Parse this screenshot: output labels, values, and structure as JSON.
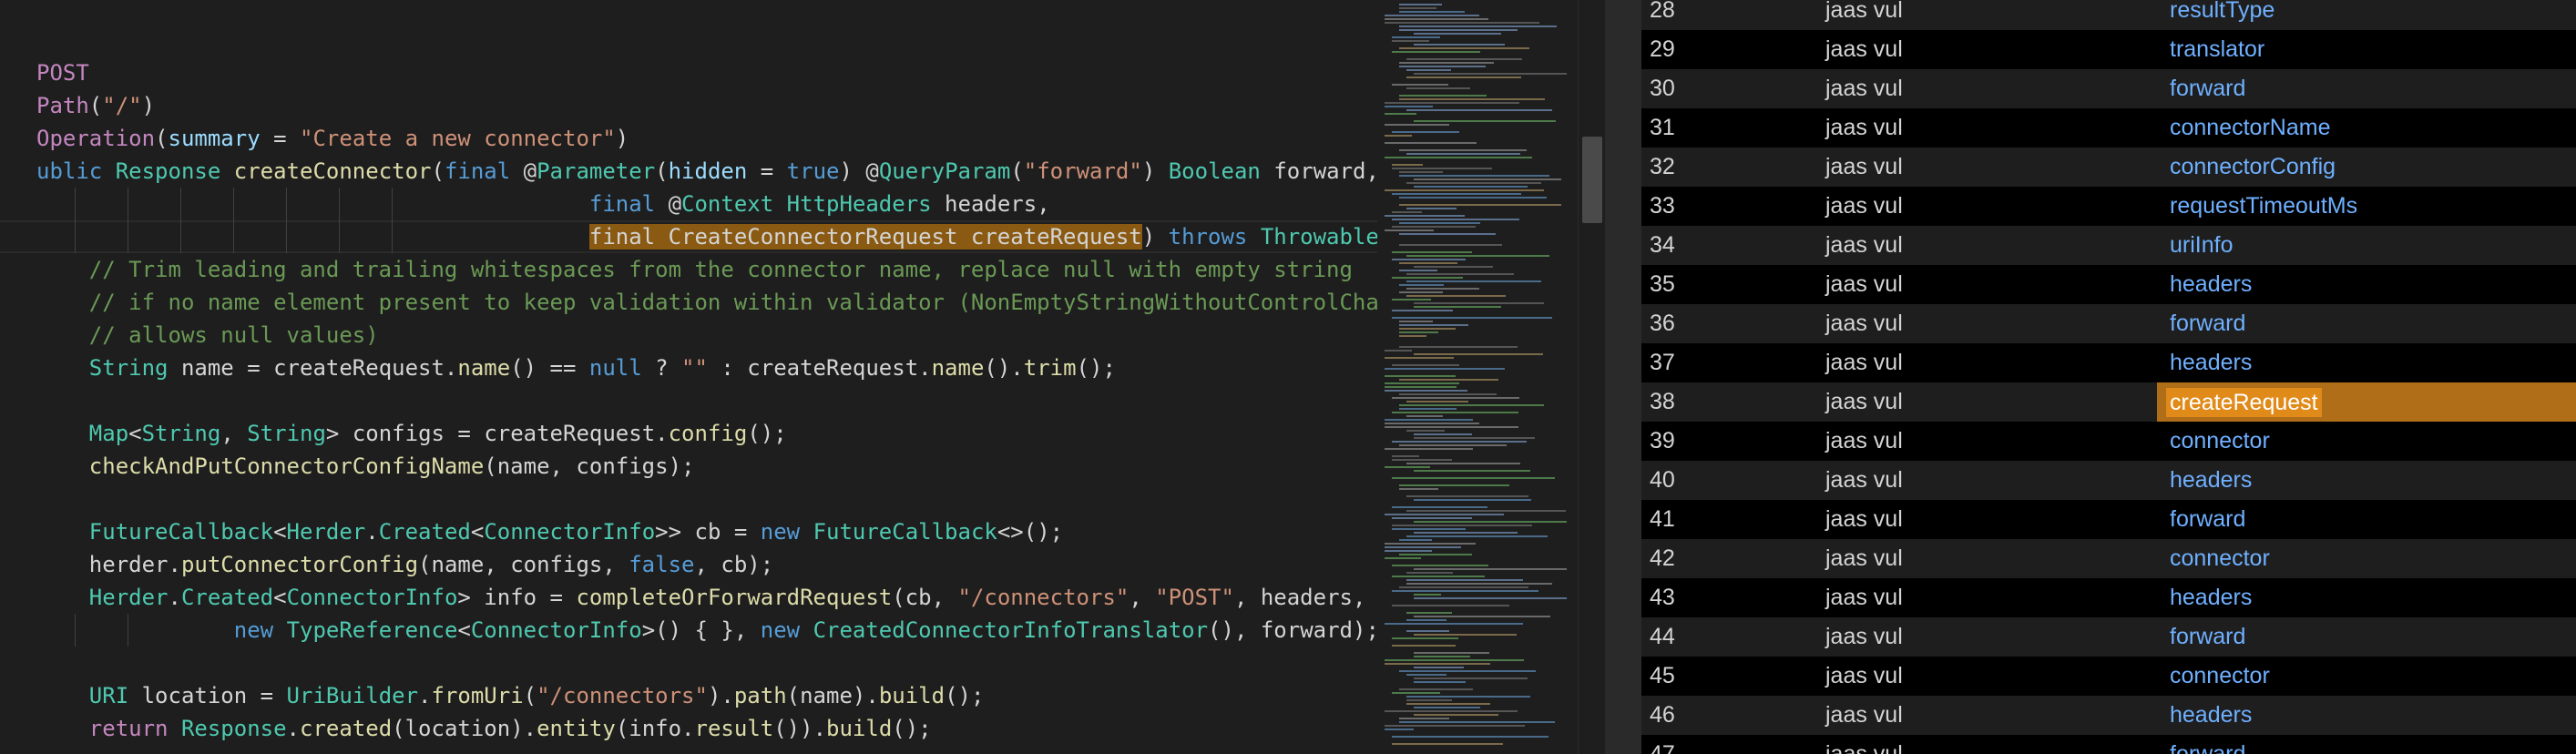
{
  "editor": {
    "lines": [
      [
        {
          "t": "POST",
          "c": "kc"
        }
      ],
      [
        {
          "t": "Path",
          "c": "kc"
        },
        {
          "t": "(",
          "c": "wh"
        },
        {
          "t": "\"/\"",
          "c": "s"
        },
        {
          "t": ")",
          "c": "wh"
        }
      ],
      [
        {
          "t": "Operation",
          "c": "kc"
        },
        {
          "t": "(",
          "c": "wh"
        },
        {
          "t": "summary",
          "c": "p"
        },
        {
          "t": " = ",
          "c": "wh"
        },
        {
          "t": "\"Create a new connector\"",
          "c": "s"
        },
        {
          "t": ")",
          "c": "wh"
        }
      ],
      [
        {
          "t": "ublic",
          "c": "k"
        },
        {
          "t": " ",
          "c": "wh"
        },
        {
          "t": "Response",
          "c": "t"
        },
        {
          "t": " ",
          "c": "wh"
        },
        {
          "t": "createConnector",
          "c": "f"
        },
        {
          "t": "(",
          "c": "wh"
        },
        {
          "t": "final",
          "c": "k"
        },
        {
          "t": " @",
          "c": "wh"
        },
        {
          "t": "Parameter",
          "c": "t"
        },
        {
          "t": "(",
          "c": "wh"
        },
        {
          "t": "hidden",
          "c": "p"
        },
        {
          "t": " = ",
          "c": "wh"
        },
        {
          "t": "true",
          "c": "k"
        },
        {
          "t": ") @",
          "c": "wh"
        },
        {
          "t": "QueryParam",
          "c": "t"
        },
        {
          "t": "(",
          "c": "wh"
        },
        {
          "t": "\"forward\"",
          "c": "s"
        },
        {
          "t": ") ",
          "c": "wh"
        },
        {
          "t": "Boolean",
          "c": "t"
        },
        {
          "t": " forward,",
          "c": "wh"
        }
      ],
      [
        {
          "t": "                                          ",
          "c": "wh"
        },
        {
          "t": "final",
          "c": "k"
        },
        {
          "t": " @",
          "c": "wh"
        },
        {
          "t": "Context",
          "c": "t"
        },
        {
          "t": " ",
          "c": "wh"
        },
        {
          "t": "HttpHeaders",
          "c": "t"
        },
        {
          "t": " headers,",
          "c": "wh"
        }
      ],
      [
        {
          "t": "                                          ",
          "c": "wh"
        },
        {
          "t": "final CreateConnectorRequest createRequest",
          "c": "sel"
        },
        {
          "t": ") ",
          "c": "wh"
        },
        {
          "t": "throws",
          "c": "k"
        },
        {
          "t": " ",
          "c": "wh"
        },
        {
          "t": "Throwable",
          "c": "t"
        },
        {
          "t": " {",
          "c": "f"
        }
      ],
      [
        {
          "t": "    // Trim leading and trailing whitespaces from the connector name, replace null with empty string",
          "c": "c"
        }
      ],
      [
        {
          "t": "    // if no name element present to keep validation within validator (NonEmptyStringWithoutControlChar",
          "c": "c"
        }
      ],
      [
        {
          "t": "    // allows null values)",
          "c": "c"
        }
      ],
      [
        {
          "t": "    ",
          "c": "wh"
        },
        {
          "t": "String",
          "c": "t"
        },
        {
          "t": " name = createRequest.",
          "c": "wh"
        },
        {
          "t": "name",
          "c": "f"
        },
        {
          "t": "() == ",
          "c": "wh"
        },
        {
          "t": "null",
          "c": "k"
        },
        {
          "t": " ? ",
          "c": "wh"
        },
        {
          "t": "\"\"",
          "c": "s"
        },
        {
          "t": " : createRequest.",
          "c": "wh"
        },
        {
          "t": "name",
          "c": "f"
        },
        {
          "t": "().",
          "c": "wh"
        },
        {
          "t": "trim",
          "c": "f"
        },
        {
          "t": "();",
          "c": "wh"
        }
      ],
      [],
      [
        {
          "t": "    ",
          "c": "wh"
        },
        {
          "t": "Map",
          "c": "t"
        },
        {
          "t": "<",
          "c": "wh"
        },
        {
          "t": "String",
          "c": "t"
        },
        {
          "t": ", ",
          "c": "wh"
        },
        {
          "t": "String",
          "c": "t"
        },
        {
          "t": "> configs = createRequest.",
          "c": "wh"
        },
        {
          "t": "config",
          "c": "f"
        },
        {
          "t": "();",
          "c": "wh"
        }
      ],
      [
        {
          "t": "    ",
          "c": "wh"
        },
        {
          "t": "checkAndPutConnectorConfigName",
          "c": "f"
        },
        {
          "t": "(name, configs);",
          "c": "wh"
        }
      ],
      [],
      [
        {
          "t": "    ",
          "c": "wh"
        },
        {
          "t": "FutureCallback",
          "c": "t"
        },
        {
          "t": "<",
          "c": "wh"
        },
        {
          "t": "Herder",
          "c": "t"
        },
        {
          "t": ".",
          "c": "wh"
        },
        {
          "t": "Created",
          "c": "t"
        },
        {
          "t": "<",
          "c": "wh"
        },
        {
          "t": "ConnectorInfo",
          "c": "t"
        },
        {
          "t": ">> cb = ",
          "c": "wh"
        },
        {
          "t": "new",
          "c": "k"
        },
        {
          "t": " ",
          "c": "wh"
        },
        {
          "t": "FutureCallback",
          "c": "t"
        },
        {
          "t": "<>();",
          "c": "wh"
        }
      ],
      [
        {
          "t": "    herder.",
          "c": "wh"
        },
        {
          "t": "putConnectorConfig",
          "c": "f"
        },
        {
          "t": "(name, configs, ",
          "c": "wh"
        },
        {
          "t": "false",
          "c": "k"
        },
        {
          "t": ", cb);",
          "c": "wh"
        }
      ],
      [
        {
          "t": "    ",
          "c": "wh"
        },
        {
          "t": "Herder",
          "c": "t"
        },
        {
          "t": ".",
          "c": "wh"
        },
        {
          "t": "Created",
          "c": "t"
        },
        {
          "t": "<",
          "c": "wh"
        },
        {
          "t": "ConnectorInfo",
          "c": "t"
        },
        {
          "t": "> info = ",
          "c": "wh"
        },
        {
          "t": "completeOrForwardRequest",
          "c": "f"
        },
        {
          "t": "(cb, ",
          "c": "wh"
        },
        {
          "t": "\"/connectors\"",
          "c": "s"
        },
        {
          "t": ", ",
          "c": "wh"
        },
        {
          "t": "\"POST\"",
          "c": "s"
        },
        {
          "t": ", headers, c",
          "c": "wh"
        }
      ],
      [
        {
          "t": "               ",
          "c": "wh"
        },
        {
          "t": "new",
          "c": "k"
        },
        {
          "t": " ",
          "c": "wh"
        },
        {
          "t": "TypeReference",
          "c": "t"
        },
        {
          "t": "<",
          "c": "wh"
        },
        {
          "t": "ConnectorInfo",
          "c": "t"
        },
        {
          "t": ">() { }, ",
          "c": "wh"
        },
        {
          "t": "new",
          "c": "k"
        },
        {
          "t": " ",
          "c": "wh"
        },
        {
          "t": "CreatedConnectorInfoTranslator",
          "c": "t"
        },
        {
          "t": "(), forward);",
          "c": "wh"
        }
      ],
      [],
      [
        {
          "t": "    ",
          "c": "wh"
        },
        {
          "t": "URI",
          "c": "t"
        },
        {
          "t": " location = ",
          "c": "wh"
        },
        {
          "t": "UriBuilder",
          "c": "t"
        },
        {
          "t": ".",
          "c": "wh"
        },
        {
          "t": "fromUri",
          "c": "f"
        },
        {
          "t": "(",
          "c": "wh"
        },
        {
          "t": "\"/connectors\"",
          "c": "s"
        },
        {
          "t": ").",
          "c": "wh"
        },
        {
          "t": "path",
          "c": "f"
        },
        {
          "t": "(name).",
          "c": "wh"
        },
        {
          "t": "build",
          "c": "f"
        },
        {
          "t": "();",
          "c": "wh"
        }
      ],
      [
        {
          "t": "    ",
          "c": "wh"
        },
        {
          "t": "return",
          "c": "kc"
        },
        {
          "t": " ",
          "c": "wh"
        },
        {
          "t": "Response",
          "c": "t"
        },
        {
          "t": ".",
          "c": "wh"
        },
        {
          "t": "created",
          "c": "f"
        },
        {
          "t": "(location).",
          "c": "wh"
        },
        {
          "t": "entity",
          "c": "f"
        },
        {
          "t": "(info.",
          "c": "wh"
        },
        {
          "t": "result",
          "c": "f"
        },
        {
          "t": "()).",
          "c": "wh"
        },
        {
          "t": "build",
          "c": "f"
        },
        {
          "t": "();",
          "c": "wh"
        }
      ]
    ]
  },
  "table": {
    "rows": [
      {
        "num": "28",
        "type": "jaas vul",
        "name": "resultType"
      },
      {
        "num": "29",
        "type": "jaas vul",
        "name": "translator"
      },
      {
        "num": "30",
        "type": "jaas vul",
        "name": "forward"
      },
      {
        "num": "31",
        "type": "jaas vul",
        "name": "connectorName"
      },
      {
        "num": "32",
        "type": "jaas vul",
        "name": "connectorConfig"
      },
      {
        "num": "33",
        "type": "jaas vul",
        "name": "requestTimeoutMs"
      },
      {
        "num": "34",
        "type": "jaas vul",
        "name": "uriInfo"
      },
      {
        "num": "35",
        "type": "jaas vul",
        "name": "headers"
      },
      {
        "num": "36",
        "type": "jaas vul",
        "name": "forward"
      },
      {
        "num": "37",
        "type": "jaas vul",
        "name": "headers"
      },
      {
        "num": "38",
        "type": "jaas vul",
        "name": "createRequest",
        "selected": true
      },
      {
        "num": "39",
        "type": "jaas vul",
        "name": "connector"
      },
      {
        "num": "40",
        "type": "jaas vul",
        "name": "headers"
      },
      {
        "num": "41",
        "type": "jaas vul",
        "name": "forward"
      },
      {
        "num": "42",
        "type": "jaas vul",
        "name": "connector"
      },
      {
        "num": "43",
        "type": "jaas vul",
        "name": "headers"
      },
      {
        "num": "44",
        "type": "jaas vul",
        "name": "forward"
      },
      {
        "num": "45",
        "type": "jaas vul",
        "name": "connector"
      },
      {
        "num": "46",
        "type": "jaas vul",
        "name": "headers"
      },
      {
        "num": "47",
        "type": "jaas vul",
        "name": "forward"
      }
    ]
  },
  "colors": {
    "background": "#1e1e1e",
    "selection": "#8a5a12",
    "row_selected": "#b06e19",
    "link_blue": "#6fb0ff"
  }
}
